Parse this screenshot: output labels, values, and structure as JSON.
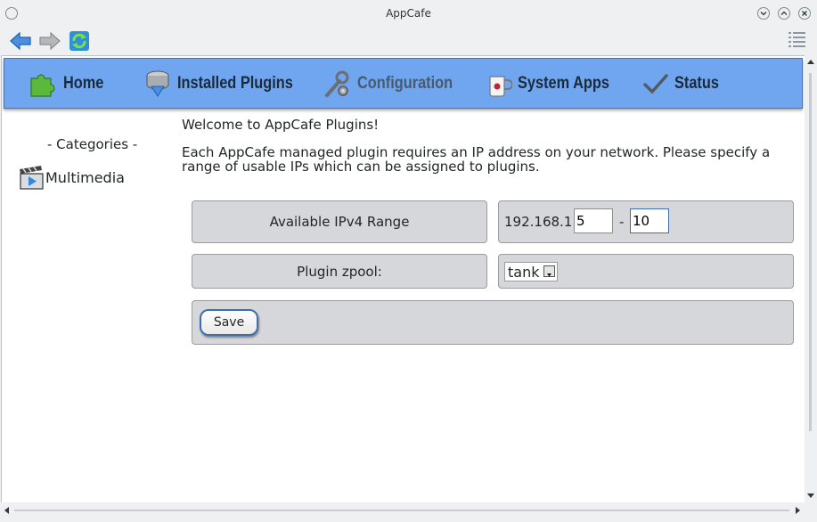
{
  "window": {
    "title": "AppCafe"
  },
  "toolbar": {
    "back_icon": "back-arrow-icon",
    "forward_icon": "forward-arrow-icon",
    "refresh_icon": "refresh-icon",
    "menu_icon": "hamburger-menu-icon"
  },
  "nav": {
    "items": [
      {
        "label": "Home",
        "icon": "puzzle-piece-icon"
      },
      {
        "label": "Installed Plugins",
        "icon": "installed-drive-icon"
      },
      {
        "label": "Configuration",
        "icon": "wrench-gear-icon",
        "active": true
      },
      {
        "label": "System Apps",
        "icon": "mug-icon"
      },
      {
        "label": "Status",
        "icon": "checkmark-icon"
      }
    ]
  },
  "sidebar": {
    "categories_label": "- Categories -",
    "items": [
      {
        "label": "Multimedia",
        "icon": "clapperboard-play-icon"
      }
    ]
  },
  "main": {
    "welcome": "Welcome to AppCafe Plugins!",
    "description": "Each AppCafe managed plugin requires an IP address on your network. Please specify a range of usable IPs which can be assigned to plugins.",
    "ip_range": {
      "label": "Available IPv4 Range",
      "prefix": "192.168.1.",
      "start": "5",
      "separator": "-",
      "end": "10"
    },
    "zpool": {
      "label": "Plugin zpool:",
      "selected": "tank"
    },
    "save_label": "Save"
  },
  "colors": {
    "nav_bg": "#6fa6ef",
    "panel_bg": "#d6d7db",
    "accent": "#3d6fb0"
  }
}
